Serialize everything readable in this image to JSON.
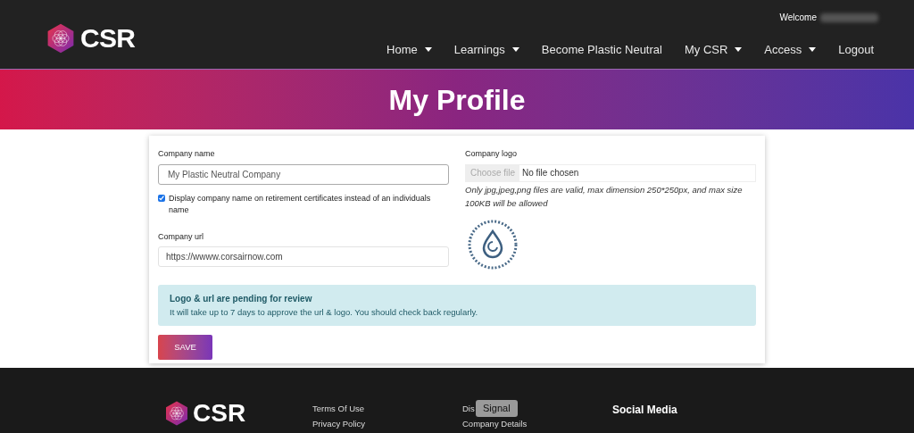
{
  "header": {
    "logo_text": "CSR",
    "welcome": "Welcome",
    "nav": [
      {
        "label": "Home",
        "dropdown": true
      },
      {
        "label": "Learnings",
        "dropdown": true
      },
      {
        "label": "Become Plastic Neutral",
        "dropdown": false
      },
      {
        "label": "My CSR",
        "dropdown": true
      },
      {
        "label": "Access",
        "dropdown": true
      },
      {
        "label": "Logout",
        "dropdown": false
      }
    ]
  },
  "banner": {
    "title": "My Profile"
  },
  "form": {
    "company_name": {
      "label": "Company name",
      "value": "My Plastic Neutral Company"
    },
    "display_name_checkbox": {
      "label": "Display company name on retirement certificates instead of an individuals name",
      "checked": true
    },
    "company_url": {
      "label": "Company url",
      "value": "https://wwww.corsairnow.com"
    },
    "company_logo": {
      "label": "Company logo",
      "button": "Choose file",
      "status": "No file chosen",
      "hint": "Only jpg,jpeg,png files are valid, max dimension 250*250px, and max size 100KB will be allowed"
    },
    "alert": {
      "title": "Logo & url are pending for review",
      "message": "It will take up to 7 days to approve the url & logo. You should check back regularly."
    },
    "save_button": "SAVE"
  },
  "footer": {
    "logo_text": "CSR",
    "columns": [
      [
        "Terms Of Use",
        "Privacy Policy"
      ],
      [
        "Dis",
        "Company Details"
      ]
    ],
    "social_heading": "Social Media"
  },
  "tooltip": "Signal"
}
